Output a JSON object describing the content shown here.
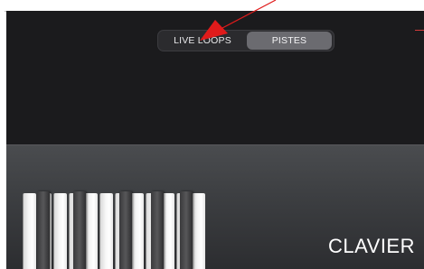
{
  "tracks_toggle": {
    "live_loops_label": "LIVE LOOPS",
    "pistes_label": "PISTES",
    "selected": "PISTES"
  },
  "instrument": {
    "name": "CLAVIER",
    "icon": "keyboard-icon"
  },
  "colors": {
    "background": "#1b1b1d",
    "segment_selected": "#6b6b70",
    "annotation_arrow": "#e01b1b"
  }
}
